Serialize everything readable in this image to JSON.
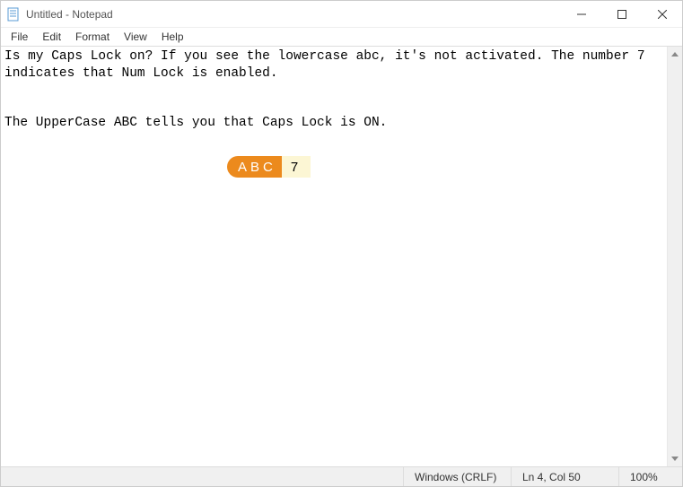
{
  "window": {
    "title": "Untitled - Notepad"
  },
  "menu": {
    "file": "File",
    "edit": "Edit",
    "format": "Format",
    "view": "View",
    "help": "Help"
  },
  "editor": {
    "content": "Is my Caps Lock on? If you see the lowercase abc, it's not activated. The number 7 indicates that Num Lock is enabled.\n\n\nThe UpperCase ABC tells you that Caps Lock is ON."
  },
  "indicator": {
    "caps": "ABC",
    "num": "7"
  },
  "statusbar": {
    "encoding": "Windows (CRLF)",
    "position": "Ln 4, Col 50",
    "zoom": "100%"
  }
}
